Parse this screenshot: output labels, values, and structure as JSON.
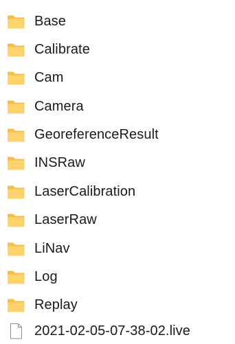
{
  "colors": {
    "folder_front": "#FFD36B",
    "folder_back": "#F5BF45",
    "file_page": "#FFFFFF",
    "file_stroke": "#8C8C8C",
    "text": "#1A1A1A"
  },
  "items": [
    {
      "label": "Base",
      "icon": "folder-icon"
    },
    {
      "label": "Calibrate",
      "icon": "folder-icon"
    },
    {
      "label": "Cam",
      "icon": "folder-icon"
    },
    {
      "label": "Camera",
      "icon": "folder-icon"
    },
    {
      "label": "GeoreferenceResult",
      "icon": "folder-icon"
    },
    {
      "label": "INSRaw",
      "icon": "folder-icon"
    },
    {
      "label": "LaserCalibration",
      "icon": "folder-icon"
    },
    {
      "label": "LaserRaw",
      "icon": "folder-icon"
    },
    {
      "label": "LiNav",
      "icon": "folder-icon"
    },
    {
      "label": "Log",
      "icon": "folder-icon"
    },
    {
      "label": "Replay",
      "icon": "folder-icon"
    },
    {
      "label": "2021-02-05-07-38-02.live",
      "icon": "file-icon"
    }
  ]
}
